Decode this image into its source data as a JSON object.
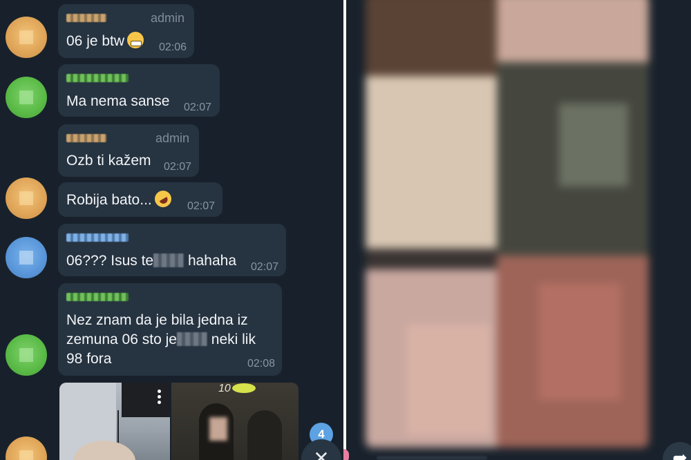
{
  "messages": [
    {
      "role": "admin",
      "text": "06 je btw",
      "time": "02:06"
    },
    {
      "text": "Ma nema sanse",
      "time": "02:07"
    },
    {
      "role": "admin",
      "text": "Ozb ti kažem",
      "time": "02:07"
    },
    {
      "text": "Robija bato...",
      "time": "02:07"
    },
    {
      "text_before": "06??? Isus te",
      "text_after": "hahaha",
      "time": "02:07"
    },
    {
      "line1": "Nez znam da je bila jedna iz",
      "line2_before": "zemuna 06 sto je",
      "line2_after": "neki lik",
      "line3": "98 fora",
      "time": "02:08"
    }
  ],
  "media": {
    "sticker_text": "10"
  },
  "unread_count": "4",
  "icons": {
    "scroll_down": "chevron-down-icon",
    "forward": "forward-arrow-icon",
    "menu": "more-vertical-icon",
    "emoji_grin": "grimacing-face-emoji",
    "emoji_rofl": "rolling-on-floor-laughing-emoji"
  },
  "colors": {
    "background": "#18212b",
    "bubble": "#263340",
    "badge": "#5da2e3",
    "time": "#8796a5"
  }
}
